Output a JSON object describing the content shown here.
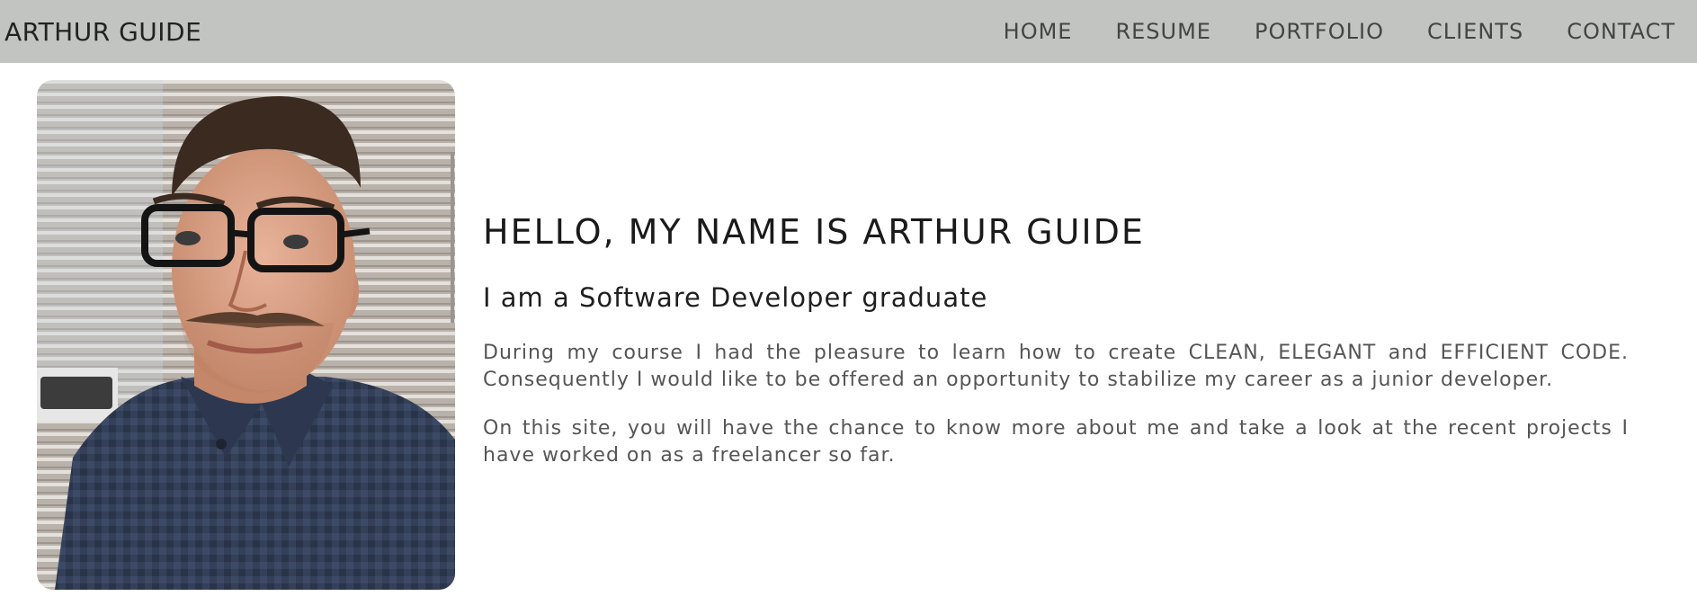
{
  "nav": {
    "brand": "ARTHUR GUIDE",
    "links": [
      "HOME",
      "RESUME",
      "PORTFOLIO",
      "CLIENTS",
      "CONTACT"
    ]
  },
  "intro": {
    "heading": "HELLO, MY NAME IS ARTHUR GUIDE",
    "subheading": "I am a Software Developer graduate",
    "paragraphs": [
      "During my course I had the pleasure to learn how to create CLEAN, ELEGANT and EFFICIENT CODE. Consequently I would like to be offered an opportunity to stabilize my career as a junior developer.",
      "On this site, you will have the chance to know more about me and take a look at the recent projects I have worked on as a freelancer so far."
    ]
  },
  "colors": {
    "navbar_bg": "#c2c4c2",
    "page_bg": "#ffffff",
    "shirt": "#34405a",
    "blinds": "#b7b0a8"
  }
}
